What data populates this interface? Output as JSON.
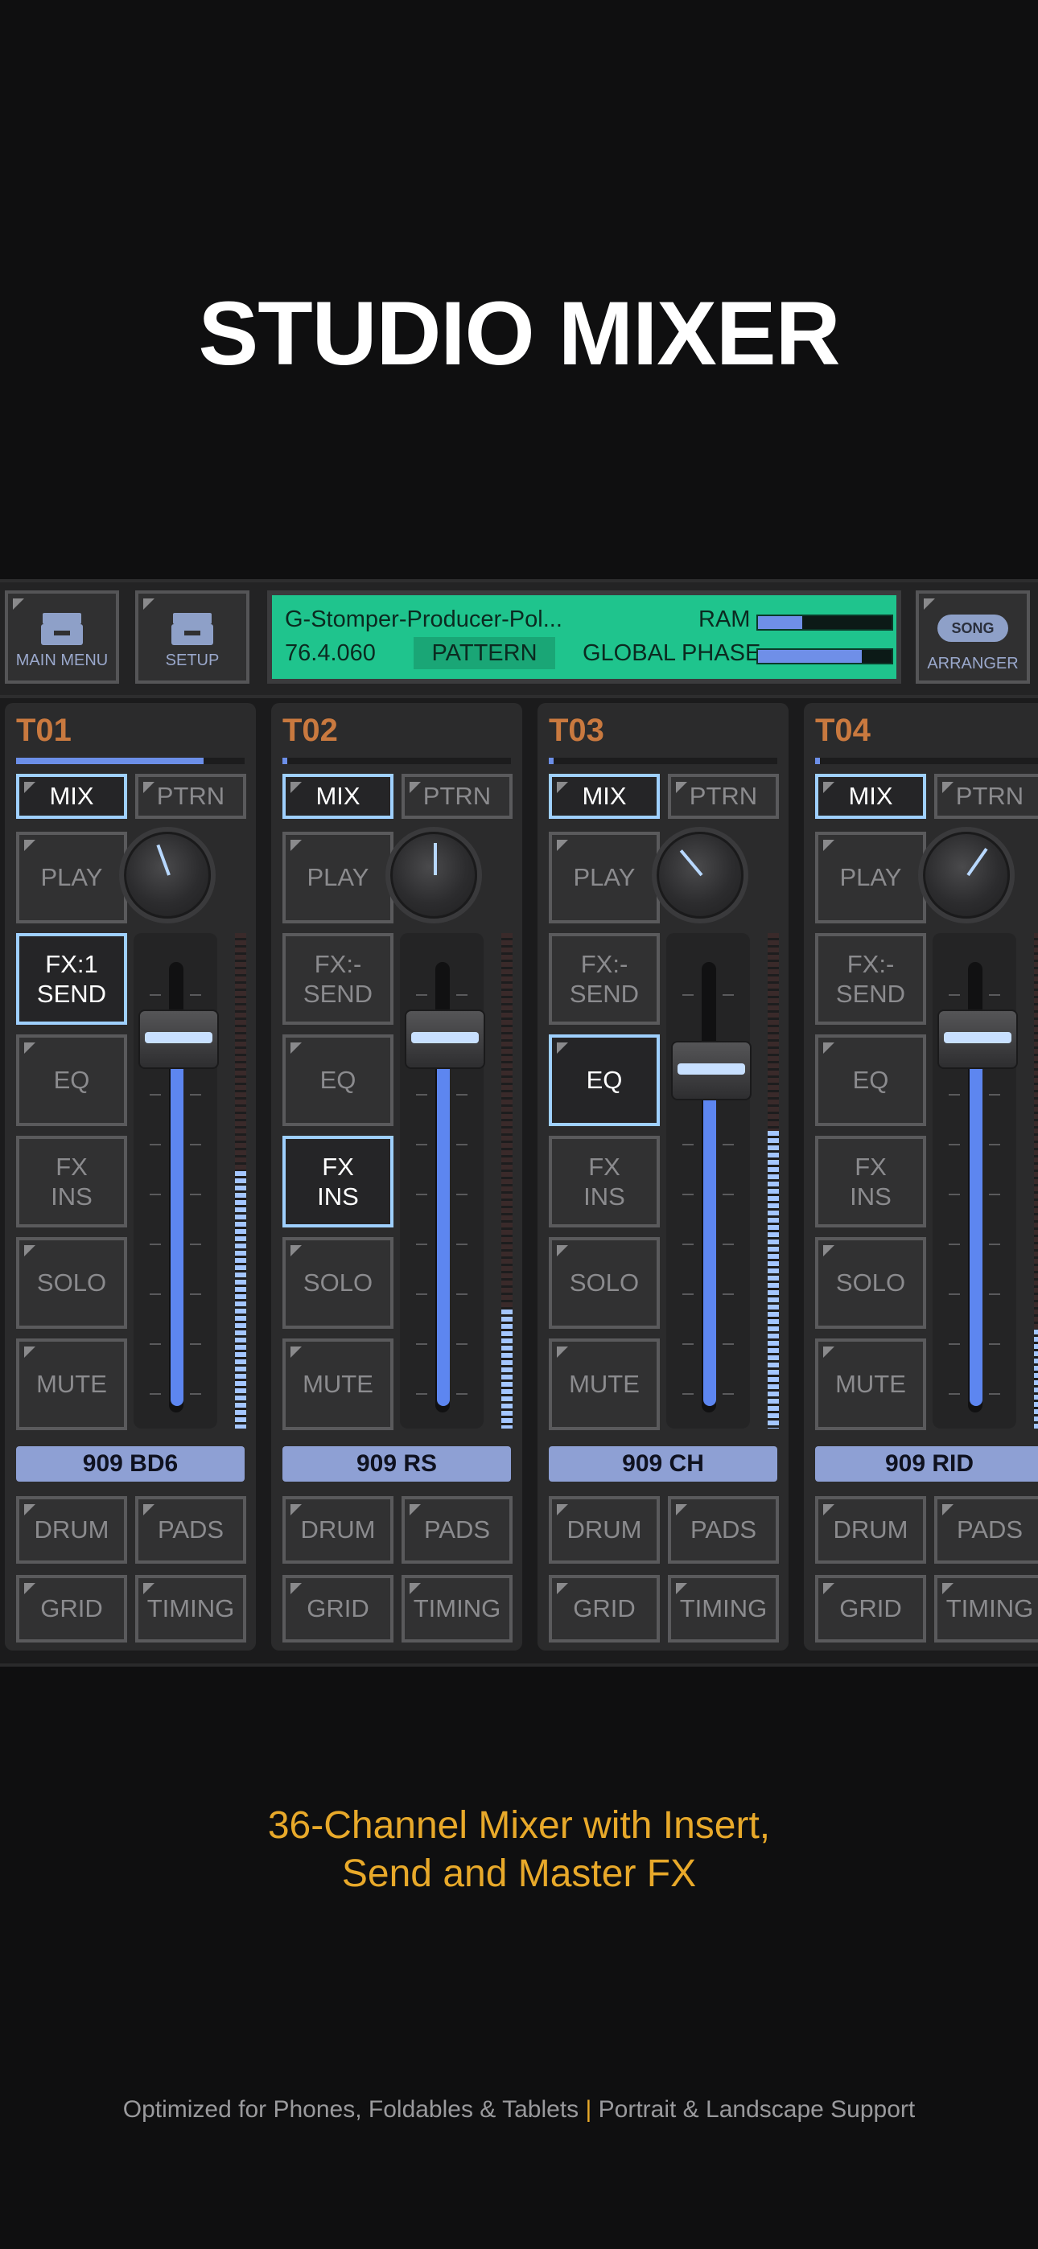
{
  "headline": "STUDIO MIXER",
  "topbar": {
    "main_menu": "MAIN MENU",
    "setup": "SETUP",
    "arranger": "ARRANGER",
    "song_pill": "SONG",
    "lcd": {
      "song_name": "G-Stomper-Producer-Pol...",
      "version": "76.4.060",
      "pattern": "PATTERN",
      "ram_label": "RAM",
      "global_phase_label": "GLOBAL PHASE",
      "ram_level": 0.33,
      "global_phase_level": 0.78
    }
  },
  "buttons": {
    "mix": "MIX",
    "ptrn": "PTRN",
    "play": "PLAY",
    "eq": "EQ",
    "fx": "FX",
    "ins": "INS",
    "send": "SEND",
    "solo": "SOLO",
    "mute": "MUTE",
    "drum": "DRUM",
    "pads": "PADS",
    "grid": "GRID",
    "timing": "TIMING"
  },
  "tracks": [
    {
      "name": "T01",
      "fx_send": "FX:1",
      "instrument": "909 BD6",
      "fader_level": 0.88,
      "vu_level": 0.52,
      "position": 0.82
    },
    {
      "name": "T02",
      "fx_send": "FX:-",
      "instrument": "909 RS",
      "fader_level": 0.88,
      "vu_level": 0.24,
      "position": 0.02
    },
    {
      "name": "T03",
      "fx_send": "FX:-",
      "instrument": "909 CH",
      "fader_level": 0.8,
      "vu_level": 0.6,
      "position": 0.02
    },
    {
      "name": "T04",
      "fx_send": "FX:-",
      "instrument": "909 RID",
      "fader_level": 0.88,
      "vu_level": 0.2,
      "position": 0.02
    }
  ],
  "tagline": {
    "line1": "36-Channel Mixer with Insert,",
    "line2": "Send and Master FX"
  },
  "footer": {
    "part1": "Optimized for Phones, Foldables & Tablets",
    "separator": "|",
    "part2": "Portrait & Landscape Support"
  },
  "colors": {
    "lcd": "#1fc48d",
    "accent_blue": "#5d86f0",
    "track_title": "#c9793f",
    "active_border": "#9fd0ff",
    "tagline": "#e8a92a"
  }
}
